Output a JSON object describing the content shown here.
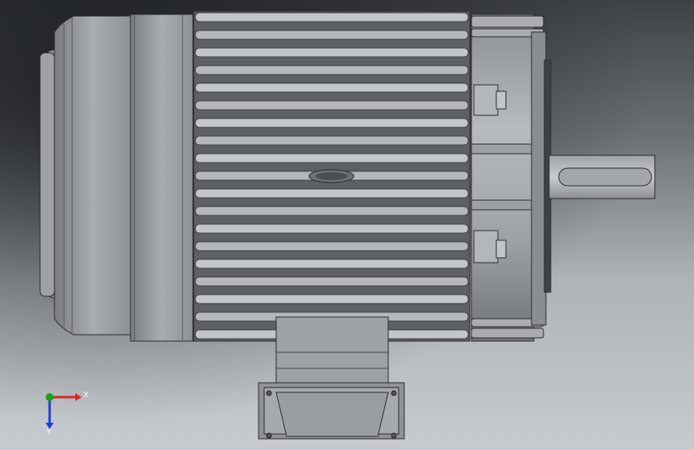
{
  "viewport": {
    "background": "gradient-grey"
  },
  "model": {
    "name": "electric-motor"
  },
  "triad": {
    "x_label": "X",
    "y_label": "Y",
    "colors": {
      "x": "#d62828",
      "y": "#1aa11a",
      "z": "#1f3bd6"
    }
  }
}
